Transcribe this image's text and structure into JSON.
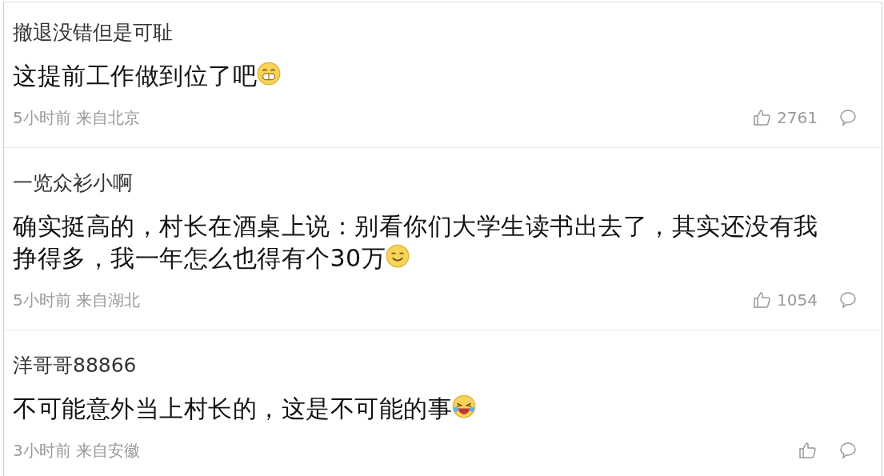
{
  "comments": [
    {
      "username": "撤退没错但是可耻",
      "text": "这提前工作做到位了吧",
      "emoji": {
        "kind": "grin"
      },
      "time": "5小时前",
      "location": "来自北京",
      "likes": "2761"
    },
    {
      "username": "一览众衫小啊",
      "text": "确实挺高的，村长在酒桌上说：别看你们大学生读书出去了，其实还没有我挣得多，我一年怎么也得有个30万",
      "emoji": {
        "kind": "smile"
      },
      "time": "5小时前",
      "location": "来自湖北",
      "likes": "1054"
    },
    {
      "username": "洋哥哥88866",
      "text": "不可能意外当上村长的，这是不可能的事",
      "emoji": {
        "kind": "laugh"
      },
      "time": "3小时前",
      "location": "来自安徽"
    }
  ]
}
